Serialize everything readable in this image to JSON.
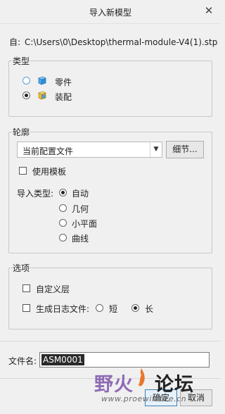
{
  "dialog": {
    "title": "导入新模型",
    "close_glyph": "✕"
  },
  "source": {
    "label": "自:",
    "path": "C:\\Users\\0\\Desktop\\thermal-module-V4(1).stp"
  },
  "type_group": {
    "title": "类型",
    "options": [
      {
        "label": "零件",
        "selected": false,
        "icon": "part-cube-icon"
      },
      {
        "label": "装配",
        "selected": true,
        "icon": "assembly-cube-icon"
      }
    ]
  },
  "profile_group": {
    "title": "轮廓",
    "profile_value": "当前配置文件",
    "details_button": "细节...",
    "use_template_label": "使用模板",
    "use_template_checked": false,
    "import_type_label": "导入类型:",
    "import_types": [
      {
        "label": "自动",
        "selected": true
      },
      {
        "label": "几何",
        "selected": false
      },
      {
        "label": "小平面",
        "selected": false
      },
      {
        "label": "曲线",
        "selected": false
      }
    ]
  },
  "options_group": {
    "title": "选项",
    "custom_layer_label": "自定义层",
    "custom_layer_checked": false,
    "log_file_label": "生成日志文件:",
    "log_file_checked": false,
    "log_short_label": "短",
    "log_long_label": "长",
    "log_selected": "长"
  },
  "filename": {
    "label": "文件名:",
    "value": "ASM0001"
  },
  "buttons": {
    "ok": "确定",
    "cancel": "取消"
  },
  "watermark": {
    "text_part1": "野火",
    "text_part2": "论坛",
    "url": "www.proewildfire.cn"
  },
  "colors": {
    "accent_blue": "#5aa0d8",
    "watermark_purple": "#8e6bb5",
    "watermark_orange": "#e8762a"
  }
}
